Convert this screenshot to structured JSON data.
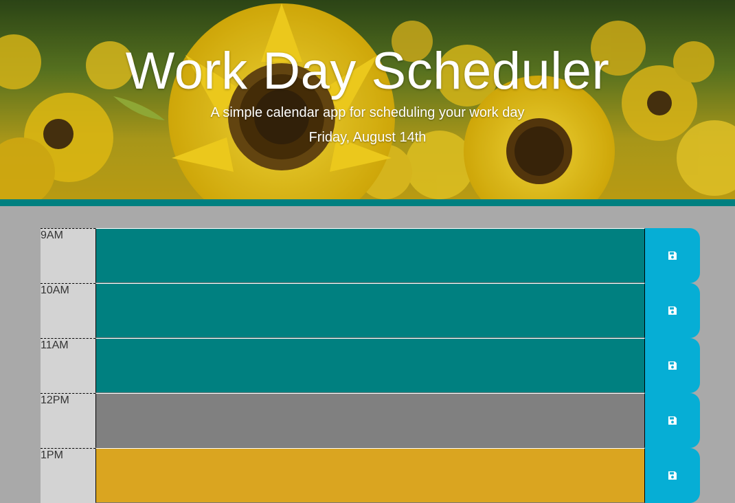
{
  "header": {
    "title": "Work Day Scheduler",
    "subtitle": "A simple calendar app for scheduling your work day",
    "current_day": "Friday, August 14th"
  },
  "colors": {
    "past": "#808080",
    "present": "#daa520",
    "future": "#008080",
    "save": "#06aed5",
    "hour_bg": "#d3d3d3",
    "accent_border": "#008080",
    "page_bg": "#a9a9a9"
  },
  "schedule": {
    "rows": [
      {
        "hour": "9AM",
        "status": "future",
        "text": "",
        "save_icon": "floppy-disk-icon"
      },
      {
        "hour": "10AM",
        "status": "future",
        "text": "",
        "save_icon": "floppy-disk-icon"
      },
      {
        "hour": "11AM",
        "status": "future",
        "text": "",
        "save_icon": "floppy-disk-icon"
      },
      {
        "hour": "12PM",
        "status": "past",
        "text": "",
        "save_icon": "floppy-disk-icon"
      },
      {
        "hour": "1PM",
        "status": "present",
        "text": "",
        "save_icon": "floppy-disk-icon"
      }
    ]
  }
}
